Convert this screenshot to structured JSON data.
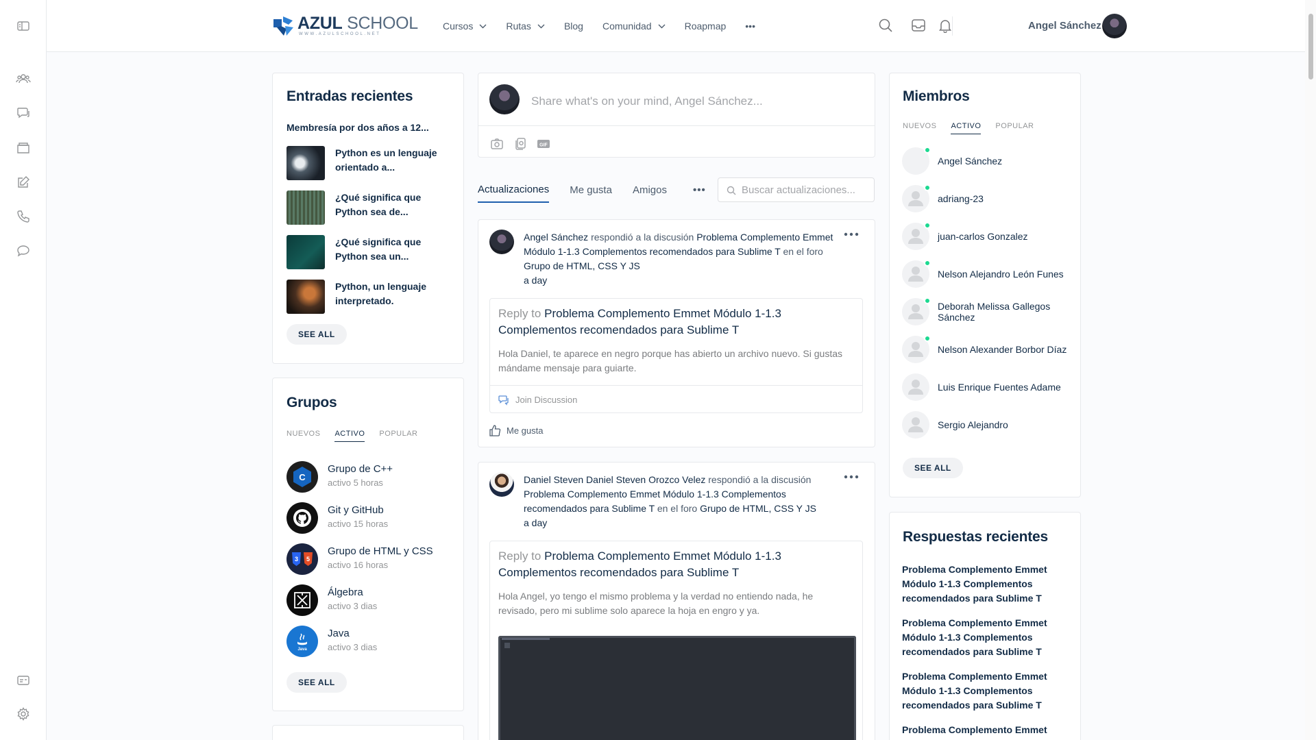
{
  "app": {
    "logo_text": "AZUL SCHOOL",
    "logo_tagline": "WWW.AZULSCHOOL.NET",
    "brand_color": "#1e5fad"
  },
  "nav": {
    "items": [
      {
        "label": "Cursos",
        "has_dropdown": true
      },
      {
        "label": "Rutas",
        "has_dropdown": true
      },
      {
        "label": "Blog",
        "has_dropdown": false
      },
      {
        "label": "Comunidad",
        "has_dropdown": true
      },
      {
        "label": "Roapmap",
        "has_dropdown": false
      },
      {
        "label": "•••",
        "has_dropdown": false
      }
    ]
  },
  "user": {
    "name": "Angel Sánchez"
  },
  "recent_posts": {
    "title": "Entradas recientes",
    "featured": "Membresía por dos años a 12...",
    "items": [
      {
        "title": "Python es un lenguaje orientado a..."
      },
      {
        "title": "¿Qué significa que Python sea de..."
      },
      {
        "title": "¿Qué significa que Python sea un..."
      },
      {
        "title": "Python, un lenguaje interpretado."
      }
    ],
    "see_all": "SEE ALL"
  },
  "groups": {
    "title": "Grupos",
    "tabs": [
      "NUEVOS",
      "ACTIVO",
      "POPULAR"
    ],
    "active_tab": "ACTIVO",
    "items": [
      {
        "name": "Grupo de C++",
        "activity": "activo 5 horas",
        "icon": "cpp-icon"
      },
      {
        "name": "Git y GitHub",
        "activity": "activo 15 horas",
        "icon": "github-icon"
      },
      {
        "name": "Grupo de HTML y CSS",
        "activity": "activo 16 horas",
        "icon": "html-css-icon"
      },
      {
        "name": "Álgebra",
        "activity": "activo 3 dias",
        "icon": "algebra-icon"
      },
      {
        "name": "Java",
        "activity": "activo 3 dias",
        "icon": "java-icon"
      }
    ],
    "see_all": "SEE ALL"
  },
  "composer": {
    "placeholder": "Share what's on your mind, Angel Sánchez..."
  },
  "activity": {
    "tabs": [
      "Actualizaciones",
      "Me gusta",
      "Amigos"
    ],
    "active_tab": "Actualizaciones",
    "more": "•••",
    "search_placeholder": "Buscar actualizaciones...",
    "items": [
      {
        "author": "Angel Sánchez",
        "action": "respondió a la discusión",
        "topic": "Problema Complemento Emmet Módulo 1-1.3 Complementos recomendados para Sublime T",
        "in_forum": "en el foro",
        "forum": "Grupo de HTML, CSS Y JS",
        "time": "a day",
        "reply_prefix": "Reply to",
        "reply_title": "Problema Complemento Emmet Módulo 1-1.3 Complementos recomendados para Sublime T",
        "reply_body": "Hola Daniel, te aparece en negro porque has abierto un archivo nuevo. Si gustas mándame mensaje para guiarte.",
        "join": "Join Discussion",
        "like": "Me gusta"
      },
      {
        "author": "Daniel Steven Daniel Steven Orozco Velez",
        "action": "respondió a la discusión",
        "topic": "Problema Complemento Emmet Módulo 1-1.3 Complementos recomendados para Sublime T",
        "in_forum": "en el foro",
        "forum": "Grupo de HTML, CSS Y JS",
        "time": "a day",
        "reply_prefix": "Reply to",
        "reply_title": "Problema Complemento Emmet Módulo 1-1.3 Complementos recomendados para Sublime T",
        "reply_body": "Hola Angel, yo tengo el mismo problema y la verdad no entiendo nada, he revisado, pero mi sublime solo aparece la hoja en engro y ya."
      }
    ]
  },
  "members": {
    "title": "Miembros",
    "tabs": [
      "NUEVOS",
      "ACTIVO",
      "POPULAR"
    ],
    "active_tab": "ACTIVO",
    "items": [
      {
        "name": "Angel Sánchez",
        "online": true
      },
      {
        "name": "adriang-23",
        "online": true
      },
      {
        "name": "juan-carlos Gonzalez",
        "online": true
      },
      {
        "name": "Nelson Alejandro León Funes",
        "online": true
      },
      {
        "name": "Deborah Melissa Gallegos Sánchez",
        "online": true
      },
      {
        "name": "Nelson Alexander Borbor Díaz",
        "online": true
      },
      {
        "name": "Luis Enrique Fuentes Adame",
        "online": false
      },
      {
        "name": "Sergio Alejandro",
        "online": false
      }
    ],
    "see_all": "SEE ALL"
  },
  "recent_replies": {
    "title": "Respuestas recientes",
    "items": [
      "Problema Complemento Emmet Módulo 1-1.3 Complementos recomendados para Sublime T",
      "Problema Complemento Emmet Módulo 1-1.3 Complementos recomendados para Sublime T",
      "Problema Complemento Emmet Módulo 1-1.3 Complementos recomendados para Sublime T",
      "Problema Complemento Emmet"
    ]
  }
}
